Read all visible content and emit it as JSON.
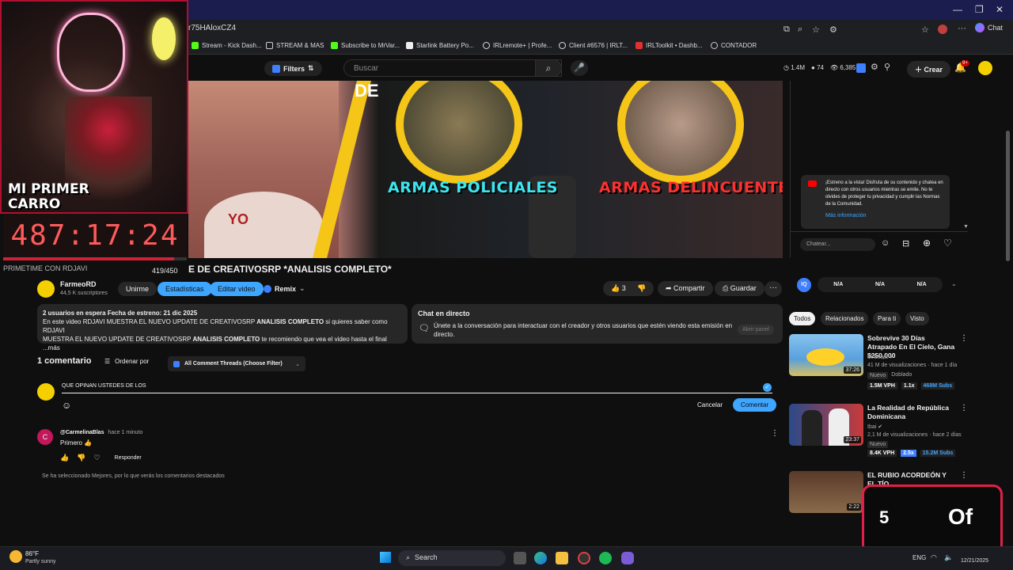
{
  "browser": {
    "url_fragment": "r75HAloxCZ4",
    "bookmarks": [
      {
        "label": "Stream - Kick Dash...",
        "color": "#53fc18"
      },
      {
        "label": "STREAM & MAS",
        "color": "#cccccc"
      },
      {
        "label": "Subscribe to MrVar...",
        "color": "#53fc18"
      },
      {
        "label": "Starlink Battery Po...",
        "color": "#eeeeee"
      },
      {
        "label": "IRLremote+ | Profe...",
        "color": "#dddddd"
      },
      {
        "label": "Client #6576 | IRLT...",
        "color": "#dddddd"
      },
      {
        "label": "IRLToolkit • Dashb...",
        "color": "#e03030"
      },
      {
        "label": "CONTADOR",
        "color": "#cccccc"
      }
    ],
    "chat_label": "Chat"
  },
  "header": {
    "filters_label": "Filters",
    "search_placeholder": "Buscar",
    "stats": [
      "1.4M",
      "74",
      "6,385"
    ],
    "create_label": "Crear",
    "notif_badge": "9+"
  },
  "video": {
    "text_left": "ARMAS POLICIALES",
    "text_right": "ARMAS DELINCUENTES",
    "text_top": "DE",
    "shirt_text": "YO",
    "title": "E DE CREATIVOSRP *ANALISIS COMPLETO*"
  },
  "overlay": {
    "badge": "MI PRIMER CARRO",
    "timer": "487:17:24",
    "primetime": "PRIMETIME CON RDJAVI",
    "progress": "419/450",
    "progress_fraction": 0.93,
    "counter_number": "5",
    "counter_text": "Of"
  },
  "channel": {
    "name": "FarmeoRD",
    "subs": "44,5 K suscriptores",
    "buttons": [
      "Unirme",
      "Estadísticas",
      "Editar video",
      "Remix"
    ]
  },
  "actions": {
    "likes": "3",
    "share": "Compartir",
    "save": "Guardar"
  },
  "description": {
    "line1": "2 usuarios en espera  Fecha de estreno: 21 dic 2025",
    "line2a": "En este video RDJAVI MUESTRA EL NUEVO UPDATE DE CREATIVOSRP ",
    "line2b": "ANALISIS COMPLETO",
    "line2c": " si quieres saber como RDJAVI",
    "line3a": "MUESTRA EL NUEVO UPDATE DE CREATIVOSRP ",
    "line3b": "ANALISIS COMPLETO",
    "line3c": " te recomiendo que vea el video hasta el final  ...más"
  },
  "chatinfo": {
    "title": "Chat en directo",
    "text": "Únete a la conversación para interactuar con el creador y otros usuarios que estén viendo esta emisión en directo.",
    "button": "Abrir panel"
  },
  "comments": {
    "count": "1 comentario",
    "sort": "Ordenar por",
    "filter": "All Comment Threads (Choose Filter)",
    "draft": "QUE OPINAN USTEDES DE LOS",
    "cancel": "Cancelar",
    "submit": "Comentar",
    "items": [
      {
        "author": "@CarmelinaBlas",
        "time": "hace 1 minuto",
        "text": "Primero 👍",
        "reply": "Responder"
      }
    ],
    "footer": "Se ha seleccionado Mejores, por lo que verás los comentarios destacados"
  },
  "sidechat": {
    "notice": "¡Estreno a la vista! Disfruta de su contenido y chatea en directo con otros usuarios mientras se emite. No te olvides de proteger tu privacidad y cumplir las Normas de la Comunidad.",
    "more": "Más información",
    "placeholder": "Chatear..."
  },
  "stats_row": [
    "N/A",
    "N/A",
    "N/A"
  ],
  "tabs": [
    "Todos",
    "Relacionados",
    "Para ti",
    "Visto"
  ],
  "recommendations": [
    {
      "title": "Sobrevive 30 Días Atrapado En El Cielo, Gana $250,000",
      "channel": "MrBeast",
      "meta": "41 M de visualizaciones · hace 1 día",
      "badge": "Nuevo",
      "dub": "Doblado",
      "vph": "1.5M VPH",
      "x": "1.1x",
      "subs": "468M Subs",
      "duration": "37:26"
    },
    {
      "title": "La Realidad de República Dominicana",
      "channel": "Ibai",
      "meta": "2,1 M de visualizaciones · hace 2 días",
      "badge": "Nuevo",
      "vph": "8.4K VPH",
      "x": "2.5x",
      "subs": "15.2M Subs",
      "duration": "23:37"
    },
    {
      "title": "EL RUBIO ACORDEÓN Y EL TÍO",
      "channel": "",
      "meta": "",
      "duration": "2:22"
    }
  ],
  "taskbar": {
    "weather_temp": "86°F",
    "weather_text": "Partly sunny",
    "search": "Search",
    "lang": "ENG",
    "date": "12/21/2025"
  },
  "colors": {
    "accent_blue": "#3ea6ff",
    "stats_blue": "#3ea6ff",
    "timer_red": "#ff5a5a",
    "youtube_bg": "#0f0f0f"
  }
}
